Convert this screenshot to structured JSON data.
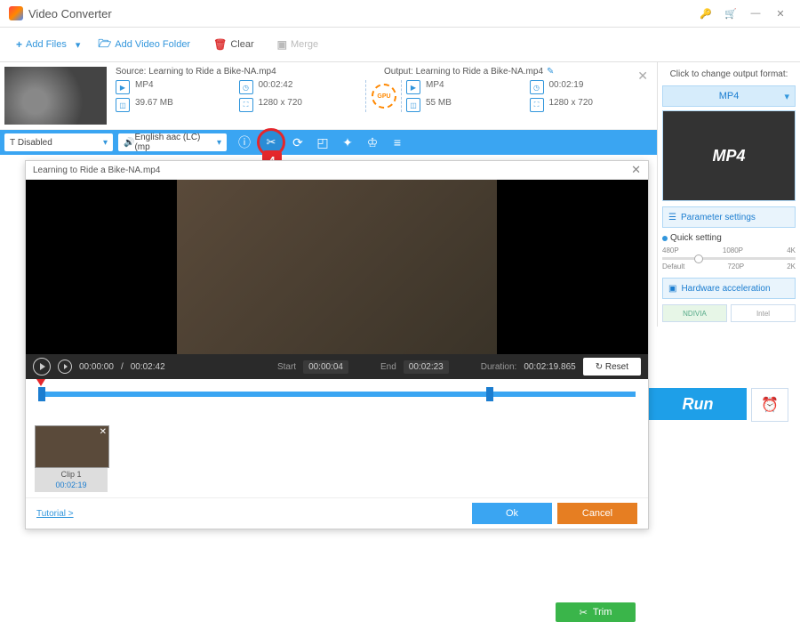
{
  "title": "Video Converter",
  "toolbar": {
    "add_files": "Add Files",
    "add_folder": "Add Video Folder",
    "clear": "Clear",
    "merge": "Merge"
  },
  "item": {
    "source_label": "Source:",
    "source_file": "Learning to Ride a Bike-NA.mp4",
    "output_label": "Output:",
    "output_file": "Learning to Ride a Bike-NA.mp4",
    "src": {
      "fmt": "MP4",
      "dur": "00:02:42",
      "size": "39.67 MB",
      "res": "1280 x 720"
    },
    "out": {
      "fmt": "MP4",
      "dur": "00:02:19",
      "size": "55 MB",
      "res": "1280 x 720"
    },
    "gpu": "GPU"
  },
  "bluebar": {
    "disabled": "Disabled",
    "audio": "English aac (LC) (mp"
  },
  "badge": "4",
  "editor": {
    "title": "Learning to Ride a Bike-NA.mp4",
    "time_cur": "00:00:00",
    "time_total": "00:02:42",
    "start_label": "Start",
    "start_val": "00:00:04",
    "end_label": "End",
    "end_val": "00:02:23",
    "duration_label": "Duration:",
    "duration_val": "00:02:19.865",
    "reset": "Reset",
    "trim": "Trim",
    "clip": {
      "name": "Clip 1",
      "dur": "00:02:19"
    },
    "tutorial": "Tutorial >",
    "ok": "Ok",
    "cancel": "Cancel"
  },
  "right": {
    "head": "Click to change output format:",
    "format": "MP4",
    "preview_text": "MP4",
    "param": "Parameter settings",
    "quick": "Quick setting",
    "ticks_top": [
      "480P",
      "1080P",
      "4K"
    ],
    "ticks_bot": [
      "Default",
      "720P",
      "2K"
    ],
    "hw": "Hardware acceleration",
    "nvidia": "NDIVIA",
    "intel": "Intel"
  },
  "run": "Run"
}
